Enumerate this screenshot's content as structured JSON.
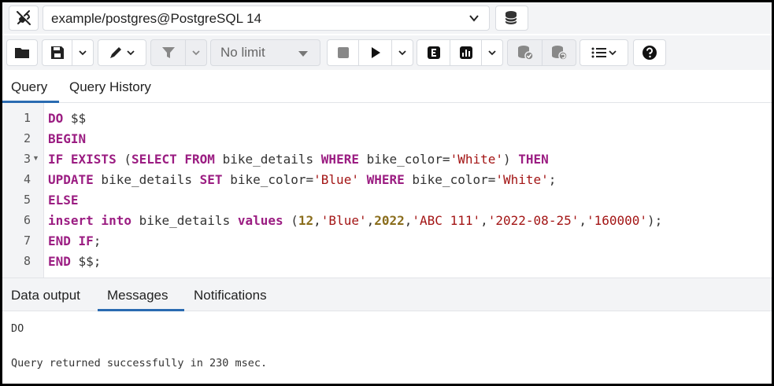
{
  "connection": {
    "label": "example/postgres@PostgreSQL 14"
  },
  "toolbar": {
    "limit_value": "No limit"
  },
  "query_tabs": [
    {
      "label": "Query",
      "active": true
    },
    {
      "label": "Query History",
      "active": false
    }
  ],
  "editor": {
    "line_numbers": [
      "1",
      "2",
      "3",
      "4",
      "5",
      "6",
      "7",
      "8"
    ],
    "lines": [
      [
        {
          "t": "DO",
          "c": "kw"
        },
        {
          "t": " $$",
          "c": ""
        }
      ],
      [
        {
          "t": "BEGIN",
          "c": "kw"
        }
      ],
      [
        {
          "t": "IF EXISTS",
          "c": "kw"
        },
        {
          "t": " (",
          "c": ""
        },
        {
          "t": "SELECT FROM",
          "c": "kw"
        },
        {
          "t": " bike_details ",
          "c": ""
        },
        {
          "t": "WHERE",
          "c": "kw"
        },
        {
          "t": " bike_color=",
          "c": ""
        },
        {
          "t": "'White'",
          "c": "str"
        },
        {
          "t": ") ",
          "c": ""
        },
        {
          "t": "THEN",
          "c": "kw"
        }
      ],
      [
        {
          "t": "UPDATE",
          "c": "kw"
        },
        {
          "t": " bike_details ",
          "c": ""
        },
        {
          "t": "SET",
          "c": "kw"
        },
        {
          "t": " bike_color=",
          "c": ""
        },
        {
          "t": "'Blue'",
          "c": "str"
        },
        {
          "t": " ",
          "c": ""
        },
        {
          "t": "WHERE",
          "c": "kw"
        },
        {
          "t": " bike_color=",
          "c": ""
        },
        {
          "t": "'White'",
          "c": "str"
        },
        {
          "t": ";",
          "c": ""
        }
      ],
      [
        {
          "t": "ELSE",
          "c": "kw"
        }
      ],
      [
        {
          "t": "insert into",
          "c": "kw"
        },
        {
          "t": " bike_details ",
          "c": ""
        },
        {
          "t": "values",
          "c": "kw"
        },
        {
          "t": " (",
          "c": ""
        },
        {
          "t": "12",
          "c": "num"
        },
        {
          "t": ",",
          "c": ""
        },
        {
          "t": "'Blue'",
          "c": "str"
        },
        {
          "t": ",",
          "c": ""
        },
        {
          "t": "2022",
          "c": "num"
        },
        {
          "t": ",",
          "c": ""
        },
        {
          "t": "'ABC 111'",
          "c": "str"
        },
        {
          "t": ",",
          "c": ""
        },
        {
          "t": "'2022-08-25'",
          "c": "str"
        },
        {
          "t": ",",
          "c": ""
        },
        {
          "t": "'160000'",
          "c": "str"
        },
        {
          "t": ");",
          "c": ""
        }
      ],
      [
        {
          "t": "END IF",
          "c": "kw"
        },
        {
          "t": ";",
          "c": ""
        }
      ],
      [
        {
          "t": "END",
          "c": "kw"
        },
        {
          "t": " $$;",
          "c": ""
        }
      ]
    ]
  },
  "result_tabs": [
    {
      "label": "Data output",
      "active": false
    },
    {
      "label": "Messages",
      "active": true
    },
    {
      "label": "Notifications",
      "active": false
    }
  ],
  "messages": {
    "line1": "DO",
    "line2": "Query returned successfully in 230 msec."
  },
  "colors": {
    "accent": "#2a6bb1",
    "keyword": "#9b1d82",
    "string": "#a31515",
    "number": "#8a6d1c"
  }
}
